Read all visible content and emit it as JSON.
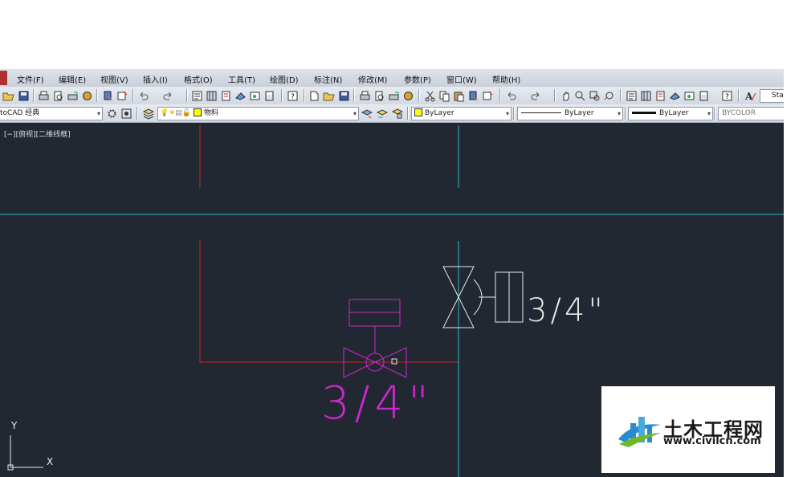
{
  "menu": [
    "文件(F)",
    "编辑(E)",
    "视图(V)",
    "插入(I)",
    "格式(O)",
    "工具(T)",
    "绘图(D)",
    "标注(N)",
    "修改(M)",
    "参数(P)",
    "窗口(W)",
    "帮助(H)"
  ],
  "toolbar": {
    "workspace": "toCAD 经典",
    "layer": "物料",
    "color": "ByLayer",
    "linetype": "ByLayer",
    "lineweight": "ByLayer",
    "plotstyle": "BYCOLOR",
    "text_style_partial": "Sta"
  },
  "viewport": {
    "label": "[−][俯视][二维线框]",
    "dimension_text_1": "3/4\"",
    "dimension_text_2": "3/4\"",
    "ucs_x": "X",
    "ucs_y": "Y"
  },
  "watermark": {
    "title": "土木工程网",
    "url": "www.civilcn.com"
  },
  "colors": {
    "background": "#222832",
    "red_line": "#c0282d",
    "cyan_line": "#2bb8c0",
    "magenta": "#cc28cc",
    "white": "#e8e8e8"
  }
}
